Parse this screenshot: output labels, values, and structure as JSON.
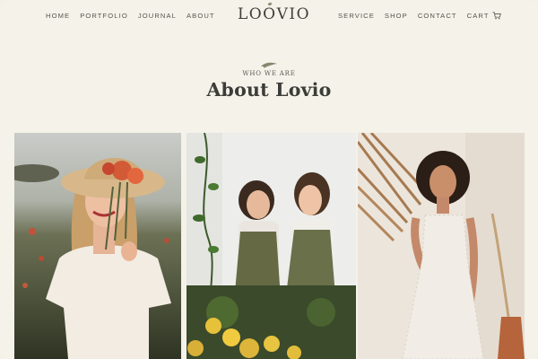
{
  "nav": {
    "left": [
      "HOME",
      "PORTFOLIO",
      "JOURNAL",
      "ABOUT"
    ],
    "right": [
      "SERVICE",
      "SHOP",
      "CONTACT"
    ],
    "cart_label": "CART"
  },
  "logo": {
    "part1": "L",
    "part2": "O",
    "part3": "O",
    "part4": "VIO"
  },
  "section": {
    "eyebrow": "WHO WE ARE",
    "title": "About Lovio"
  },
  "icons": {
    "cart": "cart-icon",
    "leaf": "leaf-icon"
  },
  "colors": {
    "background": "#f4f2e9",
    "text": "#4a4a45"
  }
}
